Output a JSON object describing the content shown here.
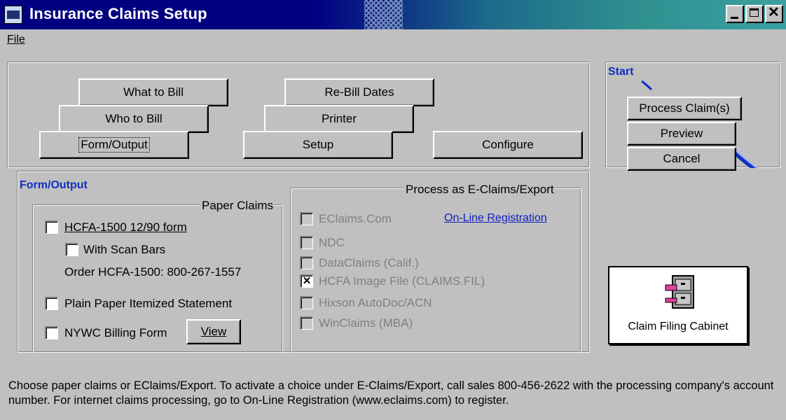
{
  "window": {
    "title": "Insurance Claims Setup"
  },
  "menu": {
    "file_label": "File"
  },
  "tabs": {
    "what_to_bill": "What to Bill",
    "who_to_bill": "Who to Bill",
    "form_output": "Form/Output",
    "rebill_dates": "Re-Bill Dates",
    "printer": "Printer",
    "setup": "Setup",
    "configure": "Configure"
  },
  "start": {
    "title": "Start",
    "process_claims": "Process Claim(s)",
    "preview": "Preview",
    "cancel": "Cancel"
  },
  "form_output": {
    "title": "Form/Output",
    "paper_claims": {
      "title": "Paper Claims",
      "hcfa_label": "HCFA-1500 12/90 form",
      "scan_bars_label": "With Scan Bars",
      "order_text": "Order HCFA-1500:  800-267-1557",
      "plain_paper_label": "Plain Paper Itemized Statement",
      "nywc_label": "NYWC Billing Form",
      "view_button": "View"
    },
    "eclaims": {
      "title": "Process as E-Claims/Export",
      "registration_link": "On-Line Registration",
      "options": [
        {
          "label": "EClaims.Com",
          "checked": false
        },
        {
          "label": "NDC",
          "checked": false
        },
        {
          "label": "DataClaims (Calif.)",
          "checked": false
        },
        {
          "label": "HCFA Image File (CLAIMS.FIL)",
          "checked": true
        },
        {
          "label": "Hixson AutoDoc/ACN",
          "checked": false
        },
        {
          "label": "WinClaims (MBA)",
          "checked": false
        }
      ]
    }
  },
  "cabinet": {
    "label": "Claim Filing Cabinet"
  },
  "status": {
    "text": "Choose paper claims or EClaims/Export.  To activate a choice under E-Claims/Export, call sales 800-456-2622 with the processing company's account number.  For internet claims processing, go to On-Line Registration (www.eclaims.com) to register."
  }
}
